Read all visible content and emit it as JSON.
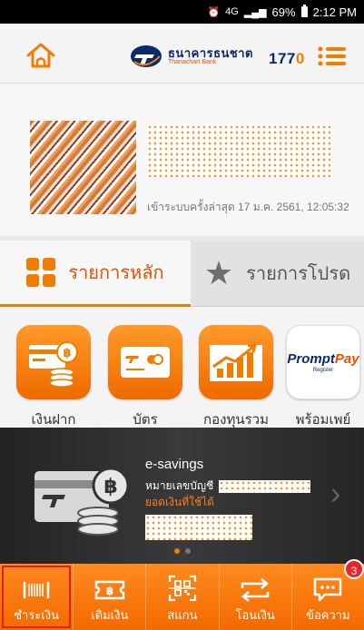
{
  "status_bar": {
    "network": "4G",
    "battery": "69%",
    "time": "2:12 PM"
  },
  "header": {
    "bank_name": "ธนาคารธนชาต",
    "bank_sub": "Thanachart Bank",
    "hotline_main": "177",
    "hotline_accent": "0"
  },
  "profile": {
    "last_login": "เข้าระบบครั้งล่าสุด 17 ม.ค. 2561, 12:05:32"
  },
  "tabs": [
    {
      "label": "รายการหลัก",
      "active": true
    },
    {
      "label": "รายการโปรด",
      "active": false
    }
  ],
  "services": [
    {
      "label": "เงินฝาก",
      "icon": "coins-icon"
    },
    {
      "label": "บัตร",
      "icon": "card-icon"
    },
    {
      "label": "กองทุนรวม",
      "icon": "chart-icon"
    },
    {
      "label": "พร้อมเพย์",
      "icon": "promptpay-icon"
    }
  ],
  "promptpay": {
    "logo_a": "Prompt",
    "logo_b": "Pay",
    "register": "Register"
  },
  "banner": {
    "title": "e-savings",
    "account_label": "หมายเลขบัญชี",
    "balance_label": "ยอดเงินที่ใช้ได้",
    "slide": 1,
    "slide_count": 2
  },
  "bottom_nav": [
    {
      "label": "ชำระเงิน",
      "icon": "barcode-icon",
      "selected": true
    },
    {
      "label": "เติมเงิน",
      "icon": "topup-icon",
      "selected": false
    },
    {
      "label": "สแกน",
      "icon": "qr-scan-icon",
      "selected": false
    },
    {
      "label": "โอนเงิน",
      "icon": "transfer-icon",
      "selected": false
    },
    {
      "label": "ข้อความ",
      "icon": "message-icon",
      "selected": false
    }
  ],
  "message_badge": "3",
  "colors": {
    "accent": "#f07c00",
    "navy": "#0a2a6b",
    "badge": "#e8262a"
  }
}
